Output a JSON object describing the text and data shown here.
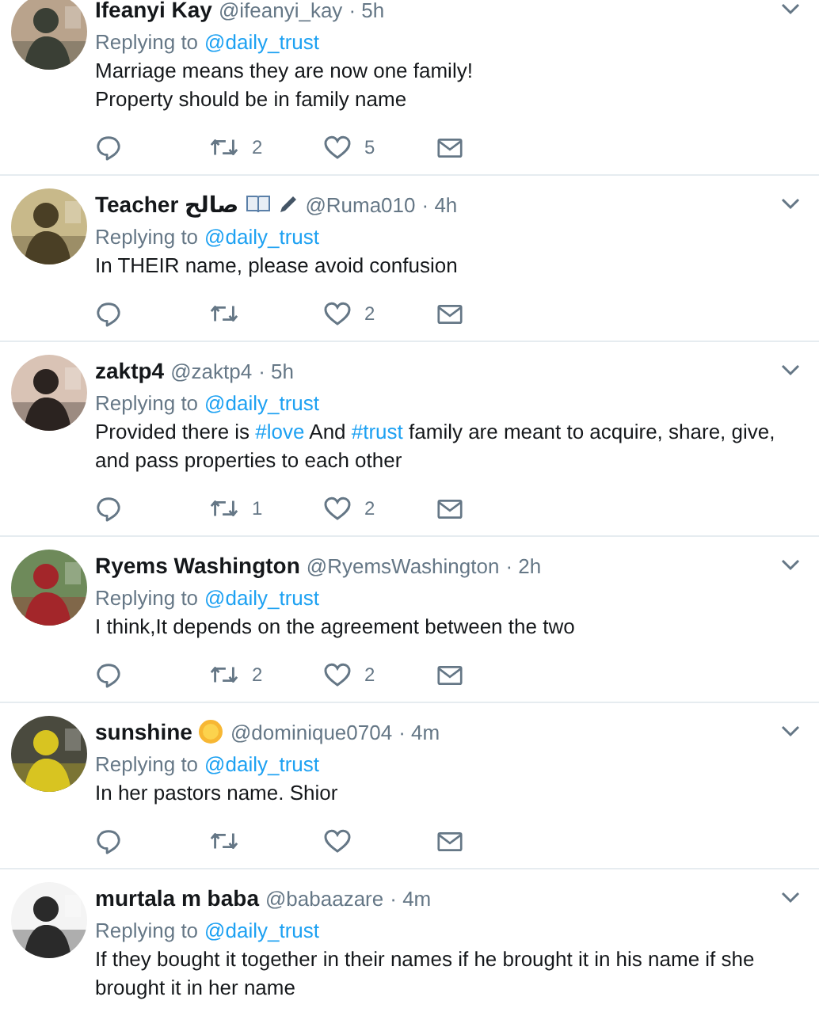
{
  "tweets": [
    {
      "name": "Ifeanyi Kay",
      "handle": "@ifeanyi_kay",
      "time": "· 5h",
      "replying_label": "Replying to",
      "replying_to": "@daily_trust",
      "avatar": {
        "kind": "picture"
      },
      "lines": [
        [
          {
            "text": "Marriage means they are now one family!"
          }
        ],
        [
          {
            "text": "Property should be in family name"
          }
        ]
      ],
      "show_actions": true,
      "retweets": "2",
      "likes": "5"
    },
    {
      "name": "Teacher صالح",
      "badges": [
        {
          "kind": "book"
        },
        {
          "kind": "pen"
        }
      ],
      "handle": "@Ruma010",
      "time": "· 4h",
      "replying_label": "Replying to",
      "replying_to": "@daily_trust",
      "avatar": {
        "kind": "picture"
      },
      "lines": [
        [
          {
            "text": "In THEIR name, please avoid confusion"
          }
        ]
      ],
      "show_actions": true,
      "likes": "2"
    },
    {
      "name": "zaktp4",
      "handle": "@zaktp4",
      "time": "· 5h",
      "replying_label": "Replying to",
      "replying_to": "@daily_trust",
      "avatar": {
        "kind": "picture"
      },
      "lines": [
        [
          {
            "text": "Provided there is "
          },
          {
            "text": "#love",
            "kind": "hashtag"
          },
          {
            "text": " And "
          },
          {
            "text": "#trust",
            "kind": "hashtag"
          },
          {
            "text": " family are meant to acquire, share, give, and pass properties to each other"
          }
        ]
      ],
      "show_actions": true,
      "retweets": "1",
      "likes": "2"
    },
    {
      "name": "Ryems Washington",
      "handle": "@RyemsWashington",
      "time": "· 2h",
      "replying_label": "Replying to",
      "replying_to": "@daily_trust",
      "avatar": {
        "kind": "picture"
      },
      "lines": [
        [
          {
            "text": "I think,It depends on the agreement between the two"
          }
        ]
      ],
      "show_actions": true,
      "retweets": "2",
      "likes": "2"
    },
    {
      "name": "sunshine",
      "badges": [
        {
          "kind": "sun"
        }
      ],
      "handle": "@dominique0704",
      "time": "· 4m",
      "replying_label": "Replying to",
      "replying_to": "@daily_trust",
      "avatar": {
        "kind": "picture"
      },
      "lines": [
        [
          {
            "text": "In her pastors name. Shior"
          }
        ]
      ],
      "show_actions": true
    },
    {
      "name": "murtala m baba",
      "handle": "@babaazare",
      "time": "· 4m",
      "replying_label": "Replying to",
      "replying_to": "@daily_trust",
      "avatar": {
        "kind": "picture"
      },
      "lines": [
        [
          {
            "text": "If they bought it together in their names if he brought it in his name if she brought it in her name"
          }
        ]
      ],
      "show_actions": false
    }
  ]
}
